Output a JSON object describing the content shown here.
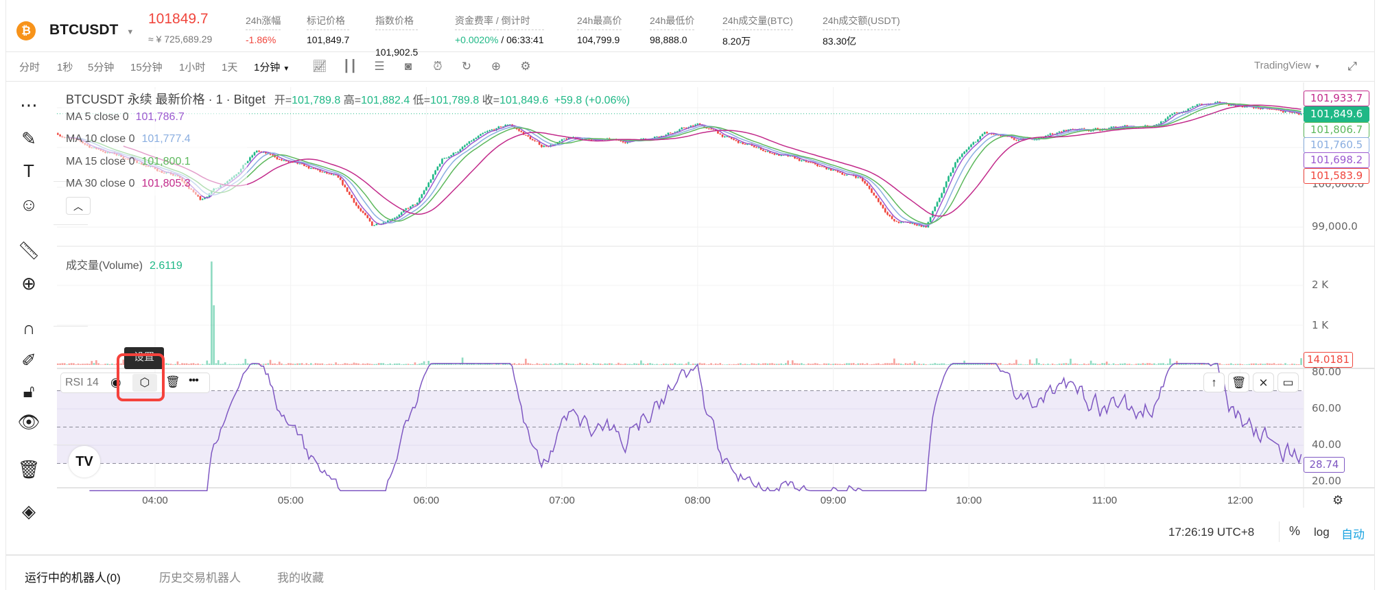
{
  "header": {
    "symbol": "BTCUSDT",
    "last_price": "101849.7",
    "cny_price": "≈ ¥ 725,689.29",
    "stats": [
      {
        "label": "24h涨幅",
        "value": "-1.86%",
        "color": "#f0453c"
      },
      {
        "label": "标记价格",
        "value": "101,849.7"
      },
      {
        "label": "指数价格",
        "value": "101,902.5",
        "icon": "external-link-icon"
      },
      {
        "label": "资金费率 / 倒计时",
        "value": "+0.0020%",
        "value2": " / 06:33:41",
        "color": "#1fb886"
      },
      {
        "label": "24h最高价",
        "value": "104,799.9"
      },
      {
        "label": "24h最低价",
        "value": "98,888.0"
      },
      {
        "label": "24h成交量(BTC)",
        "value": "8.20万"
      },
      {
        "label": "24h成交额(USDT)",
        "value": "83.30亿"
      }
    ]
  },
  "toolbar": {
    "timeframes": [
      "分时",
      "1秒",
      "5分钟",
      "15分钟",
      "1小时",
      "1天"
    ],
    "active_timeframe": "1分钟",
    "icons": [
      "indicators-icon",
      "candle-type-icon",
      "layout-icon",
      "camera-icon",
      "alarm-icon",
      "replay-icon",
      "add-icon",
      "settings-icon"
    ],
    "view_mode": "TradingView"
  },
  "left_tools": [
    "trend-line-icon",
    "brush-icon",
    "text-icon",
    "emoji-icon",
    "ruler-icon",
    "zoom-in-icon",
    "magnet-icon",
    "lock-drawing-icon",
    "unlock-icon",
    "eye-icon",
    "trash-icon",
    "layers-icon"
  ],
  "chart": {
    "title": "BTCUSDT 永续 最新价格 · 1 · Bitget",
    "ohlc": {
      "o_label": "开=",
      "o": "101,789.8",
      "h_label": "高=",
      "h": "101,882.4",
      "l_label": "低=",
      "l": "101,789.8",
      "c_label": "收=",
      "c": "101,849.6",
      "change": "+59.8 (+0.06%)"
    },
    "ma": [
      {
        "label": "MA 5 close 0",
        "value": "101,786.7",
        "color": "#9b59d0",
        "axis": "101,698.2"
      },
      {
        "label": "MA 10 close 0",
        "value": "101,777.4",
        "color": "#8aaee0",
        "axis": "101,760.5"
      },
      {
        "label": "MA 15 close 0",
        "value": "101,800.1",
        "color": "#5cb85c",
        "axis": "101,806.7"
      },
      {
        "label": "MA 30 close 0",
        "value": "101,805.3",
        "color": "#c2298a",
        "axis": "101,933.7"
      }
    ],
    "last_price_label": "101,849.6",
    "low_label": "101,583.9",
    "price_axis": [
      "100,000.0",
      "99,000.0"
    ],
    "volume": {
      "label": "成交量(Volume)",
      "value": "2.6119",
      "axis": [
        "2 K",
        "1 K"
      ],
      "last": "14.0181"
    },
    "rsi": {
      "label": "RSI 14",
      "axis": [
        "80.00",
        "60.00",
        "40.00",
        "20.00"
      ],
      "last": "28.74",
      "tooltip": "设置",
      "buttons": [
        "eye-icon",
        "settings-icon",
        "trash-icon",
        "more-icon"
      ],
      "right_buttons": [
        "move-up-icon",
        "trash-icon",
        "collapse-icon",
        "maximize-icon"
      ]
    },
    "time_axis": [
      "04:00",
      "05:00",
      "06:00",
      "07:00",
      "08:00",
      "09:00",
      "10:00",
      "11:00",
      "12:00"
    ],
    "colors": {
      "up": "#1fb886",
      "down": "#f0453c",
      "rsi": "#7e57c2",
      "rsi_band": "#efebf8"
    }
  },
  "chart_data": {
    "type": "candlestick",
    "interval": "1m",
    "price_path": {
      "time": [
        "03:17",
        "03:31",
        "03:50",
        "04:10",
        "04:20",
        "04:33",
        "04:45",
        "05:01",
        "05:20",
        "05:36",
        "05:48",
        "05:56",
        "06:07",
        "06:23",
        "06:37",
        "06:51",
        "07:06",
        "07:26",
        "07:46",
        "08:01",
        "08:17",
        "08:37",
        "08:56",
        "09:12",
        "09:27",
        "09:41",
        "09:55",
        "10:07",
        "10:22",
        "10:46",
        "11:02",
        "11:21",
        "11:41",
        "12:00",
        "12:16",
        "12:27"
      ],
      "price": [
        101356,
        101022,
        100690,
        100244,
        99690,
        100244,
        100911,
        100578,
        100244,
        99022,
        99356,
        99578,
        100690,
        101244,
        101578,
        101022,
        101244,
        101133,
        101356,
        101578,
        101133,
        100800,
        100467,
        100244,
        99133,
        99022,
        100690,
        101356,
        101133,
        101467,
        101467,
        101578,
        102067,
        102067,
        101911,
        101850
      ]
    },
    "volume_spike": {
      "time": "04:25",
      "value": 2600
    },
    "price_ylim": [
      98500,
      102500
    ]
  },
  "status": {
    "time": "17:26:19 UTC+8",
    "percent": "%",
    "log": "log",
    "auto": "自动"
  },
  "bottom_tabs": [
    "运行中的机器人(0)",
    "历史交易机器人",
    "我的收藏"
  ]
}
